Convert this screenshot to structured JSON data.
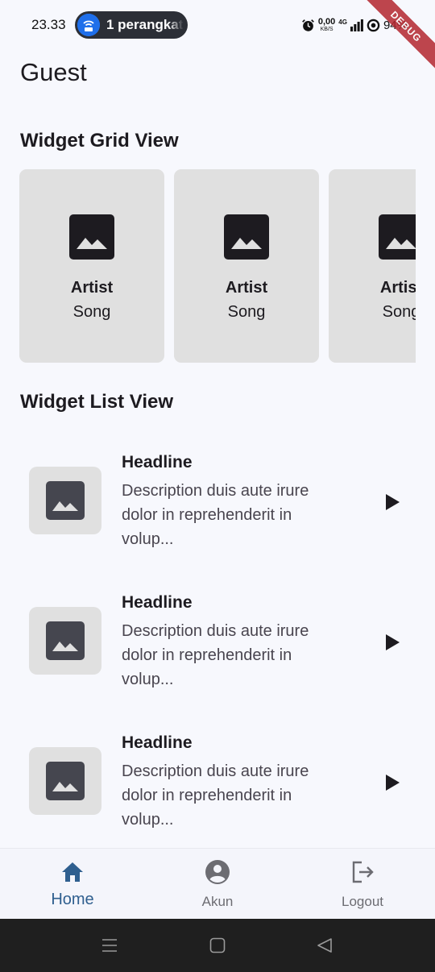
{
  "status_bar": {
    "time": "23.33",
    "hotspot_text": "1 perangkat",
    "net_speed_value": "0,00",
    "net_speed_unit": "KB/S",
    "network_type": "4G",
    "battery": "94%",
    "debug_banner": "DEBUG"
  },
  "app_bar": {
    "title": "Guest"
  },
  "grid_section": {
    "title": "Widget Grid View",
    "cards": [
      {
        "artist": "Artist",
        "song": "Song",
        "icon": "image-icon"
      },
      {
        "artist": "Artist",
        "song": "Song",
        "icon": "image-icon"
      },
      {
        "artist": "Artist",
        "song": "Song",
        "icon": "image-icon"
      }
    ]
  },
  "list_section": {
    "title": "Widget List View",
    "items": [
      {
        "headline": "Headline",
        "description": "Description duis aute irure dolor in reprehenderit in volup...",
        "icon": "image-icon",
        "action_icon": "play-icon"
      },
      {
        "headline": "Headline",
        "description": "Description duis aute irure dolor in reprehenderit in volup...",
        "icon": "image-icon",
        "action_icon": "play-icon"
      },
      {
        "headline": "Headline",
        "description": "Description duis aute irure dolor in reprehenderit in volup...",
        "icon": "image-icon",
        "action_icon": "play-icon"
      }
    ]
  },
  "bottom_nav": {
    "items": [
      {
        "label": "Home",
        "icon": "home-icon",
        "selected": true
      },
      {
        "label": "Akun",
        "icon": "account-circle-icon",
        "selected": false
      },
      {
        "label": "Logout",
        "icon": "logout-icon",
        "selected": false
      }
    ]
  },
  "colors": {
    "background": "#f7f8fd",
    "card": "#e0e0e0",
    "selected_nav": "#2f5f8f",
    "unselected_nav": "#6c6c72",
    "debug_ribbon": "#b3262f"
  }
}
